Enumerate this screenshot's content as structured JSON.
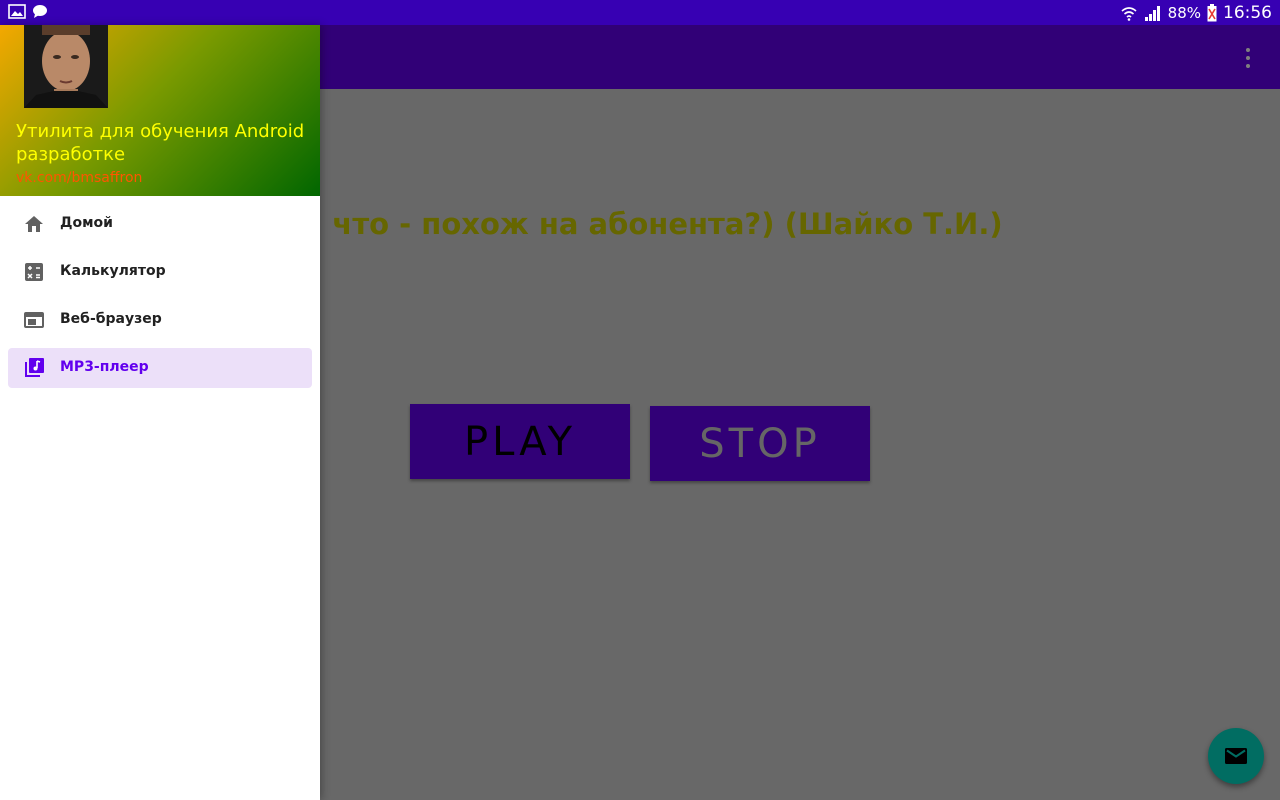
{
  "status_bar": {
    "battery": "88%",
    "time": "16:56",
    "icons": [
      "gallery-icon",
      "chat-icon",
      "wifi-icon",
      "signal-icon",
      "battery-icon"
    ]
  },
  "app": {
    "song_title": "Я что - похож на абонента?) (Шайко Т.И.)",
    "play_label": "PLAY",
    "stop_label": "STOP",
    "fab_icon": "email-icon"
  },
  "drawer": {
    "header_title": "Утилита для обучения Android разработке",
    "header_subtitle": "vk.com/bmsaffron",
    "items": [
      {
        "label": "Домой",
        "icon": "home-icon",
        "selected": false
      },
      {
        "label": "Калькулятор",
        "icon": "calculator-icon",
        "selected": false
      },
      {
        "label": "Веб-браузер",
        "icon": "web-browser-icon",
        "selected": false
      },
      {
        "label": "MP3-плеер",
        "icon": "music-library-icon",
        "selected": true
      }
    ]
  },
  "colors": {
    "primary": "#6200ee",
    "primary_dark": "#3700b3",
    "accent": "#03dac5",
    "header_title": "#ffff00",
    "header_subtitle": "#ff5500",
    "selected_item_bg": "#ece0f9"
  }
}
